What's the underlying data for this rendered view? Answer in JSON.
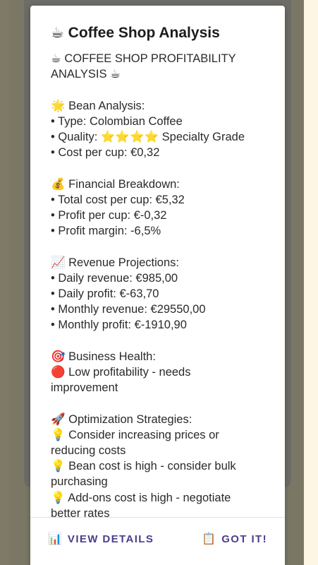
{
  "dialog": {
    "title": "☕ Coffee Shop Analysis",
    "lines": [
      "☕ COFFEE SHOP PROFITABILITY",
      "ANALYSIS ☕",
      "",
      "🌟 Bean Analysis:",
      "• Type: Colombian Coffee",
      "• Quality: ⭐⭐⭐⭐ Specialty Grade",
      "• Cost per cup: €0,32",
      "",
      "💰 Financial Breakdown:",
      "• Total cost per cup: €5,32",
      "• Profit per cup: €-0,32",
      "• Profit margin: -6,5%",
      "",
      "📈 Revenue Projections:",
      "• Daily revenue: €985,00",
      "• Daily profit: €-63,70",
      "• Monthly revenue: €29550,00",
      "• Monthly profit: €-1910,90",
      "",
      "🎯 Business Health:",
      "🔴 Low profitability - needs",
      "improvement",
      "",
      "🚀 Optimization Strategies:",
      "💡 Consider increasing prices or",
      "reducing costs",
      "💡 Bean cost is high - consider bulk",
      "purchasing",
      "💡 Add-ons cost is high - negotiate",
      "better rates"
    ]
  },
  "actions": {
    "details_icon": "📊",
    "details_label": "VIEW DETAILS",
    "gotit_icon": "📋",
    "gotit_label": "GOT IT!"
  },
  "colors": {
    "accent": "#4b3d8c",
    "scrim": "#7a7864",
    "dialog_bg": "#ffffff"
  }
}
